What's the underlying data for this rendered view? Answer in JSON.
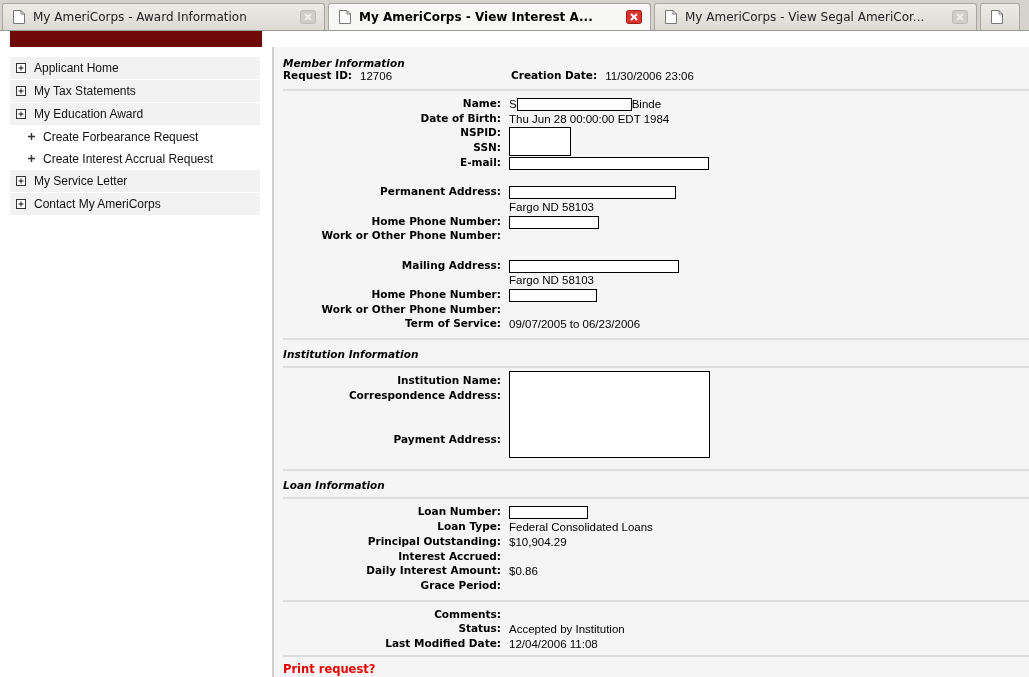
{
  "tabs": [
    {
      "label": "My AmeriCorps - Award Information",
      "selected": false
    },
    {
      "label": "My AmeriCorps - View Interest A...",
      "selected": true
    },
    {
      "label": "My AmeriCorps - View Segal AmeriCor...",
      "selected": false
    },
    {
      "selected": false
    }
  ],
  "sidebar": {
    "items": [
      {
        "label": "Applicant Home"
      },
      {
        "label": "My Tax Statements"
      },
      {
        "label": "My Education Award",
        "children": [
          {
            "label": "Create Forbearance Request"
          },
          {
            "label": "Create Interest Accrual Request"
          }
        ]
      },
      {
        "label": "My Service Letter"
      },
      {
        "label": "Contact My AmeriCorps"
      }
    ]
  },
  "sections": [
    {
      "heading": "Member Information",
      "summary": [
        {
          "label": "Request ID:",
          "value": "12706"
        },
        {
          "label": "Creation Date:",
          "value": "11/30/2006 23:06"
        }
      ],
      "blocks": [
        [
          {
            "label": "Name:",
            "value": "S",
            "value_after": "Binde",
            "redacted": true
          },
          {
            "label": "Date of Birth:",
            "value": "Thu Jun 28 00:00:00 EDT 1984"
          },
          {
            "label": "NSPID:",
            "redacted": true
          },
          {
            "label": "SSN:"
          },
          {
            "label": "E-mail:",
            "redacted": true
          }
        ],
        [
          {
            "label": "Permanent Address:",
            "redacted": true
          },
          {
            "value": "Fargo ND 58103"
          },
          {
            "label": "Home Phone Number:",
            "redacted": true
          },
          {
            "label": "Work or Other Phone Number:"
          }
        ],
        [
          {
            "label": "Mailing Address:",
            "redacted": true
          },
          {
            "value": "Fargo ND 58103"
          },
          {
            "label": "Home Phone Number:",
            "redacted": true
          },
          {
            "label": "Work or Other Phone Number:"
          },
          {
            "label": "Term of Service:",
            "value": "09/07/2005 to 06/23/2006"
          }
        ]
      ]
    },
    {
      "heading": "Institution Information",
      "blocks": [
        [
          {
            "label": "Institution Name:",
            "redacted": true
          },
          {
            "label": "Correspondence Address:"
          }
        ],
        [
          {
            "label": "Payment Address:"
          }
        ]
      ]
    },
    {
      "heading": "Loan Information",
      "blocks": [
        [
          {
            "label": "Loan Number:",
            "redacted": true
          },
          {
            "label": "Loan Type:",
            "value": "Federal Consolidated Loans"
          },
          {
            "label": "Principal Outstanding:",
            "value": "$10,904.29"
          },
          {
            "label": "Interest Accrued:"
          },
          {
            "label": "Daily Interest Amount:",
            "value": "$0.86"
          },
          {
            "label": "Grace Period:"
          }
        ]
      ]
    },
    {
      "blocks": [
        [
          {
            "label": "Comments:"
          },
          {
            "label": "Status:",
            "value": "Accepted by Institution"
          },
          {
            "label": "Last Modified Date:",
            "value": "12/04/2006 11:08"
          }
        ]
      ]
    }
  ],
  "print_link": "Print request?"
}
